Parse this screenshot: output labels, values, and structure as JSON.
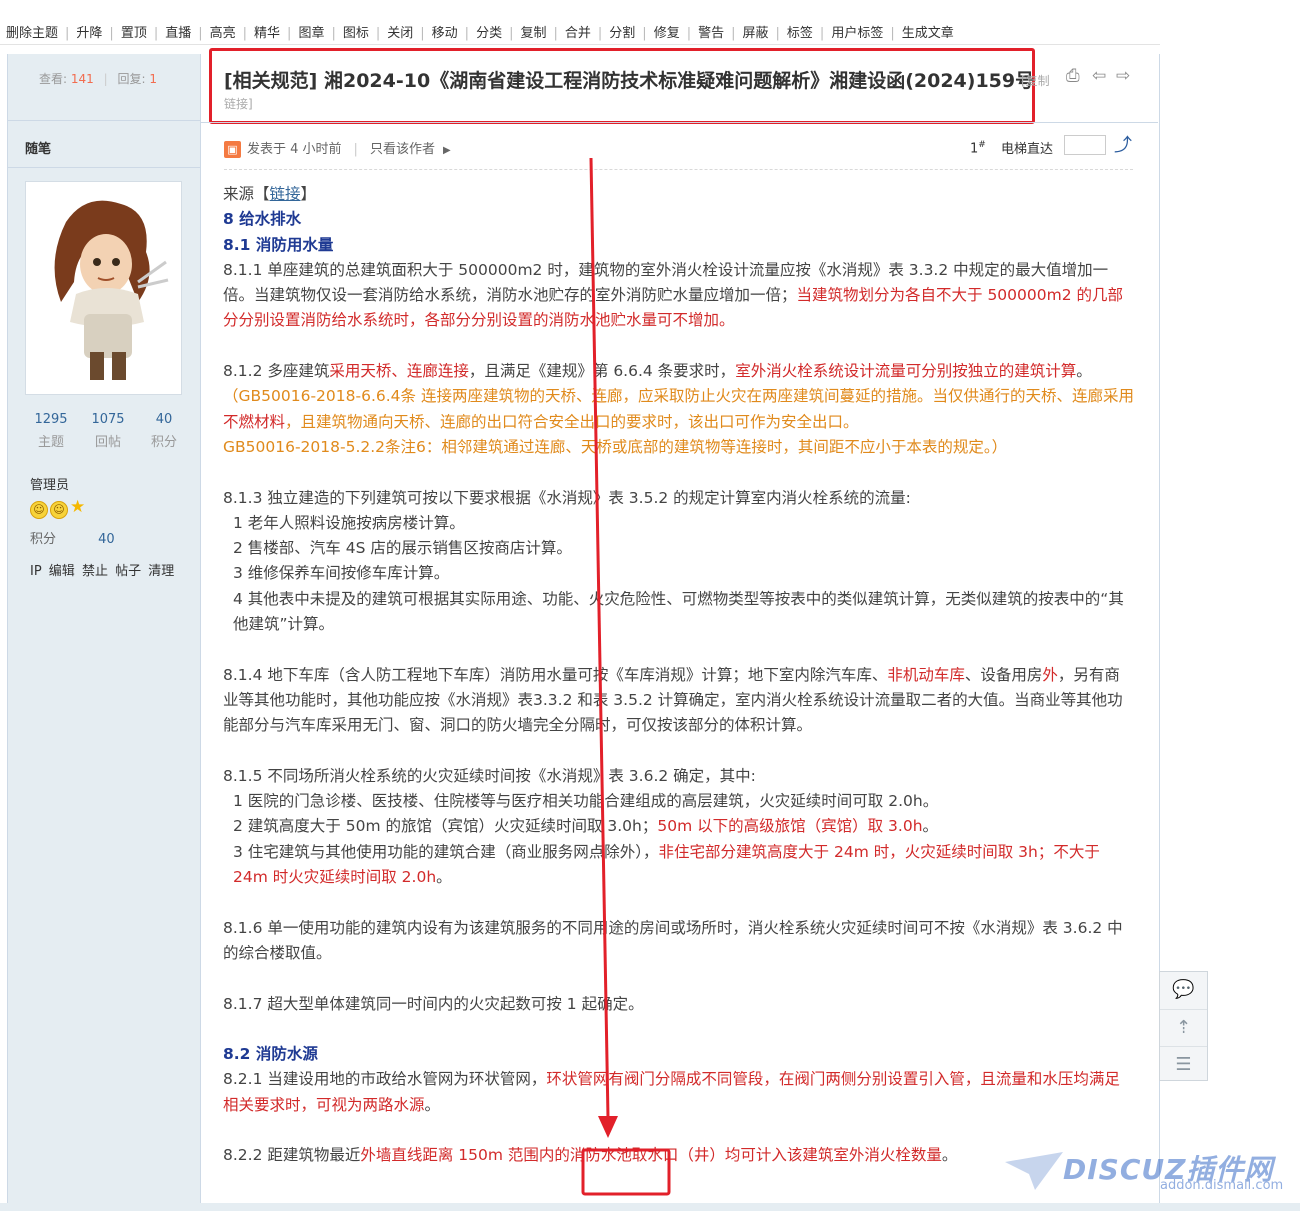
{
  "mod_bar": {
    "items": [
      "删除主题",
      "升降",
      "置顶",
      "直播",
      "高亮",
      "精华",
      "图章",
      "图标",
      "关闭",
      "移动",
      "分类",
      "复制",
      "合并",
      "分割",
      "修复",
      "警告",
      "屏蔽",
      "标签",
      "用户标签",
      "生成文章"
    ]
  },
  "sidebar": {
    "views_label": "查看:",
    "views": "141",
    "replies_label": "回复:",
    "replies": "1",
    "author": "随笔",
    "stats": [
      {
        "value": "1295",
        "label": "主题"
      },
      {
        "value": "1075",
        "label": "回帖"
      },
      {
        "value": "40",
        "label": "积分"
      }
    ],
    "group": "管理员",
    "score_label": "积分",
    "score_value": "40",
    "tools": "IP 编辑 禁止 帖子 清理"
  },
  "thread": {
    "title": "[相关规范] 湘2024-10《湖南省建设工程消防技术标准疑难问题解析》湘建设函(2024)159号",
    "copy_label": "[复制",
    "link_label": "链接]"
  },
  "post": {
    "time": "发表于 4 小时前",
    "author_only": "只看该作者",
    "floor": "1",
    "floor_sup": "#",
    "jump_label": "电梯直达"
  },
  "content": {
    "source_prefix": "来源【",
    "source_link": "链接",
    "source_suffix": "】",
    "h8": "8 给水排水",
    "h81": "8.1 消防用水量",
    "p811a": "8.1.1 单座建筑的总建筑面积大于 500000m2 时，建筑物的室外消火栓设计流量应按《水消规》表 3.3.2 中规定的最大值增加一倍。当建筑物仅设一套消防给水系统，消防水池贮存的室外消防贮水量应增加一倍；",
    "p811b": "当建筑物划分为各自不大于 500000m2 的几部分分别设置消防给水系统时，各部分分别设置的消防水池贮水量可不增加。",
    "p812a": "8.1.2 多座建筑",
    "p812b": "采用天桥、连廊连接",
    "p812c": "，且满足《建规》第 6.6.4 条要求时，",
    "p812d": "室外消火栓系统设计流量可分别按独立的建筑计算",
    "p812e": "。",
    "note1a": "（GB50016-2018-6.6.4条 连接两座建筑物的天桥、连廊，应采取防止火灾在两座建筑间蔓延的措施。当仅供通行的天桥、连廊采用",
    "note1b": "不燃材料",
    "note1c": "，且建筑物通向天桥、连廊的出口符合安全出口的要求时，该出口可作为安全出口。",
    "note2": "GB50016-2018-5.2.2条注6：相邻建筑通过连廊、天桥或底部的建筑物等连接时，其间距不应小于本表的规定。）",
    "p813": "8.1.3 独立建造的下列建筑可按以下要求根据《水消规》表 3.5.2 的规定计算室内消火栓系统的流量:",
    "p813_1": "1 老年人照料设施按病房楼计算。",
    "p813_2": "2 售楼部、汽车 4S 店的展示销售区按商店计算。",
    "p813_3": "3 维修保养车间按修车库计算。",
    "p813_4": "4 其他表中未提及的建筑可根据其实际用途、功能、火灾危险性、可燃物类型等按表中的类似建筑计算，无类似建筑的按表中的“其他建筑”计算。",
    "p814a": "8.1.4 地下车库（含人防工程地下车库）消防用水量可按《车库消规》计算；地下室内除汽车库、",
    "p814b": "非机动车库",
    "p814c": "、设备用房",
    "p814d": "外",
    "p814e": "，另有商业等其他功能时，其他功能应按《水消规》表3.3.2 和表 3.5.2 计算确定，室内消火栓系统设计流量取二者的大值。当商业等其他功能部分与汽车库采用无门、窗、洞口的防火墙完全分隔时，可仅按该部分的体积计算。",
    "p815": "8.1.5 不同场所消火栓系统的火灾延续时间按《水消规》表 3.6.2 确定，其中:",
    "p815_1": "1 医院的门急诊楼、医技楼、住院楼等与医疗相关功能合建组成的高层建筑，火灾延续时间可取 2.0h。",
    "p815_2a": "2 建筑高度大于 50m 的旅馆（宾馆）火灾延续时间取 3.0h；",
    "p815_2b": "50m 以下的高级旅馆（宾馆）取 3.0h",
    "p815_2c": "。",
    "p815_3a": "3 住宅建筑与其他使用功能的建筑合建（商业服务网点除外），",
    "p815_3b": "非住宅部分建筑高度大于 24m 时，火灾延续时间取 3h；不大于 24m 时火灾延续时间取 2.0h",
    "p815_3c": "。",
    "p816": "8.1.6 单一使用功能的建筑内设有为该建筑服务的不同用途的房间或场所时，消火栓系统火灾延续时间可不按《水消规》表 3.6.2 中的综合楼取值。",
    "p817": "8.1.7 超大型单体建筑同一时间内的火灾起数可按 1 起确定。",
    "h82": "8.2 消防水源",
    "p821a": "8.2.1 当建设用地的市政给水管网为环状管网，",
    "p821b": "环状管网有阀门分隔成不同管段，在阀门两侧分别设置引入管，且流量和水压均满足相关要求时，可视为两路水源",
    "p821c": "。",
    "p822a": "8.2.2 距建筑物最近",
    "p822b": "外墙直线距离 150m 范围内的消防水池取水口（井）均可计入该建筑室外消火栓数量",
    "p822c": "。"
  },
  "float_tools": [
    "comment-icon",
    "back-to-top-icon",
    "list-icon"
  ],
  "watermark": {
    "big": "DISCUZ插件网",
    "small": "addon.dismall.com"
  },
  "colors": {
    "highlight_red": "#e2202a",
    "text_red": "#d22a2a",
    "text_orange": "#e08a1c",
    "heading_blue": "#1f3a93",
    "sidebar_bg": "#e5edf2"
  }
}
